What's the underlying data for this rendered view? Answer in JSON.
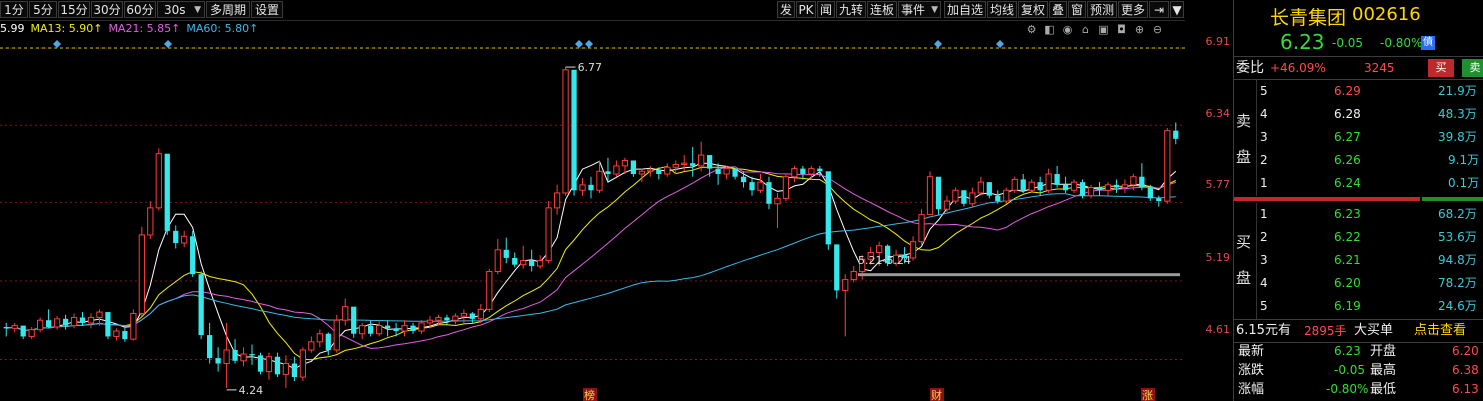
{
  "toolbar": {
    "left": [
      "1分",
      "5分",
      "15分",
      "30分",
      "60分",
      "30s"
    ],
    "period_arrow": "▼",
    "multi_period": "多周期",
    "settings": "设置",
    "right": [
      "发",
      "PK",
      "闻",
      "九转",
      "连板",
      "事件"
    ],
    "event_arrow": "▼",
    "right2": [
      "加自选",
      "均线",
      "复权",
      "叠",
      "窗",
      "预测",
      "更多"
    ],
    "pin": "⇥",
    "pin_arrow": "▼"
  },
  "ma_legend": {
    "price": "5.99",
    "ma13": "MA13: 5.90↑",
    "ma21": "MA21: 5.85↑",
    "ma60": "MA60: 5.80↑"
  },
  "colors": {
    "up": "#ff3b3b",
    "down": "#35e8ec",
    "ma_short": "#ffffff",
    "ma13": "#f0f000",
    "ma21": "#e060e0",
    "ma60": "#39b9e8",
    "grid": "#7a1a1a",
    "dash_top": "#c8c800",
    "support": "#9a9a9a"
  },
  "price_axis": [
    "6.91",
    "6.34",
    "5.77",
    "5.19",
    "4.61"
  ],
  "chart_data": {
    "type": "candlestick",
    "ylim": [
      4.34,
      6.97
    ],
    "annotations": {
      "high": "6.77",
      "low": "4.24",
      "range": "5.21-5.24"
    },
    "bottom_markers": [
      "榜",
      "财",
      "涨"
    ],
    "bars": [
      [
        4.85,
        4.88,
        4.78,
        4.84
      ],
      [
        4.84,
        4.88,
        4.81,
        4.86
      ],
      [
        4.86,
        4.85,
        4.76,
        4.78
      ],
      [
        4.78,
        4.85,
        4.76,
        4.83
      ],
      [
        4.83,
        4.92,
        4.81,
        4.9
      ],
      [
        4.9,
        4.98,
        4.84,
        4.85
      ],
      [
        4.85,
        4.93,
        4.83,
        4.91
      ],
      [
        4.91,
        4.94,
        4.83,
        4.86
      ],
      [
        4.86,
        4.95,
        4.84,
        4.92
      ],
      [
        4.92,
        4.96,
        4.86,
        4.88
      ],
      [
        4.88,
        4.95,
        4.84,
        4.92
      ],
      [
        4.92,
        4.98,
        4.86,
        4.96
      ],
      [
        4.96,
        4.96,
        4.76,
        4.78
      ],
      [
        4.78,
        4.84,
        4.75,
        4.82
      ],
      [
        4.82,
        4.85,
        4.74,
        4.76
      ],
      [
        4.76,
        4.98,
        4.75,
        4.95
      ],
      [
        4.95,
        5.59,
        4.93,
        5.53
      ],
      [
        5.53,
        5.78,
        5.5,
        5.73
      ],
      [
        5.73,
        6.17,
        5.71,
        6.13
      ],
      [
        6.13,
        5.9,
        5.53,
        5.56
      ],
      [
        5.56,
        5.6,
        5.43,
        5.47
      ],
      [
        5.47,
        5.56,
        5.44,
        5.52
      ],
      [
        5.52,
        5.56,
        5.22,
        5.24
      ],
      [
        5.24,
        5.26,
        4.76,
        4.79
      ],
      [
        4.79,
        4.88,
        4.58,
        4.62
      ],
      [
        4.62,
        4.7,
        4.52,
        4.58
      ],
      [
        4.58,
        4.88,
        4.4,
        4.68
      ],
      [
        4.68,
        4.76,
        4.58,
        4.6
      ],
      [
        4.6,
        4.7,
        4.56,
        4.65
      ],
      [
        4.65,
        4.72,
        4.57,
        4.64
      ],
      [
        4.64,
        4.66,
        4.5,
        4.52
      ],
      [
        4.52,
        4.66,
        4.46,
        4.63
      ],
      [
        4.63,
        4.66,
        4.48,
        4.5
      ],
      [
        4.5,
        4.64,
        4.4,
        4.58
      ],
      [
        4.58,
        4.63,
        4.45,
        4.48
      ],
      [
        4.48,
        4.7,
        4.45,
        4.68
      ],
      [
        4.68,
        4.78,
        4.66,
        4.74
      ],
      [
        4.74,
        4.83,
        4.7,
        4.8
      ],
      [
        4.8,
        4.81,
        4.64,
        4.68
      ],
      [
        4.68,
        4.94,
        4.66,
        4.9
      ],
      [
        4.9,
        5.06,
        4.86,
        5.0
      ],
      [
        5.0,
        4.97,
        4.77,
        4.8
      ],
      [
        4.8,
        4.88,
        4.76,
        4.86
      ],
      [
        4.86,
        4.9,
        4.78,
        4.8
      ],
      [
        4.8,
        4.9,
        4.78,
        4.86
      ],
      [
        4.86,
        4.9,
        4.78,
        4.84
      ],
      [
        4.84,
        4.88,
        4.78,
        4.82
      ],
      [
        4.82,
        4.9,
        4.78,
        4.86
      ],
      [
        4.86,
        4.88,
        4.8,
        4.82
      ],
      [
        4.82,
        4.9,
        4.8,
        4.88
      ],
      [
        4.88,
        4.93,
        4.84,
        4.9
      ],
      [
        4.9,
        4.94,
        4.86,
        4.92
      ],
      [
        4.92,
        4.94,
        4.86,
        4.9
      ],
      [
        4.9,
        4.95,
        4.87,
        4.93
      ],
      [
        4.93,
        4.98,
        4.88,
        4.95
      ],
      [
        4.95,
        4.96,
        4.88,
        4.91
      ],
      [
        4.91,
        5.02,
        4.88,
        4.98
      ],
      [
        4.98,
        5.28,
        4.96,
        5.26
      ],
      [
        5.26,
        5.5,
        5.24,
        5.42
      ],
      [
        5.42,
        5.51,
        5.32,
        5.36
      ],
      [
        5.36,
        5.4,
        5.29,
        5.31
      ],
      [
        5.31,
        5.45,
        5.28,
        5.34
      ],
      [
        5.34,
        5.42,
        5.26,
        5.3
      ],
      [
        5.3,
        5.38,
        5.28,
        5.34
      ],
      [
        5.34,
        5.78,
        5.32,
        5.73
      ],
      [
        5.73,
        5.9,
        5.68,
        5.84
      ],
      [
        5.84,
        6.77,
        5.82,
        6.75
      ],
      [
        6.75,
        5.98,
        5.82,
        5.86
      ],
      [
        5.86,
        5.95,
        5.82,
        5.9
      ],
      [
        5.9,
        5.96,
        5.8,
        5.86
      ],
      [
        5.86,
        6.08,
        5.84,
        6.0
      ],
      [
        6.0,
        6.1,
        5.92,
        5.98
      ],
      [
        5.98,
        6.08,
        5.96,
        6.04
      ],
      [
        6.04,
        6.1,
        5.98,
        6.08
      ],
      [
        6.08,
        6.06,
        5.96,
        5.98
      ],
      [
        5.98,
        6.02,
        5.92,
        6.0
      ],
      [
        6.0,
        6.04,
        5.96,
        6.01
      ],
      [
        6.01,
        6.03,
        5.94,
        5.98
      ],
      [
        5.98,
        6.06,
        5.96,
        6.03
      ],
      [
        6.03,
        6.08,
        5.98,
        6.05
      ],
      [
        6.05,
        6.12,
        6.0,
        6.06
      ],
      [
        6.06,
        6.18,
        5.96,
        6.04
      ],
      [
        6.04,
        6.22,
        6.0,
        6.12
      ],
      [
        6.12,
        6.06,
        5.96,
        6.02
      ],
      [
        6.02,
        6.06,
        5.9,
        5.98
      ],
      [
        5.98,
        6.04,
        5.94,
        6.02
      ],
      [
        6.02,
        6.02,
        5.94,
        5.96
      ],
      [
        5.96,
        6.0,
        5.88,
        5.92
      ],
      [
        5.92,
        5.96,
        5.82,
        5.86
      ],
      [
        5.86,
        5.98,
        5.84,
        5.92
      ],
      [
        5.92,
        5.96,
        5.72,
        5.76
      ],
      [
        5.76,
        5.84,
        5.58,
        5.8
      ],
      [
        5.8,
        5.98,
        5.78,
        5.96
      ],
      [
        5.96,
        6.04,
        5.92,
        6.02
      ],
      [
        6.02,
        6.04,
        5.94,
        5.98
      ],
      [
        5.98,
        6.04,
        5.94,
        6.02
      ],
      [
        6.02,
        6.04,
        5.96,
        6.0
      ],
      [
        6.0,
        5.72,
        5.42,
        5.46
      ],
      [
        5.46,
        5.34,
        5.06,
        5.12
      ],
      [
        5.12,
        5.24,
        4.78,
        5.2
      ],
      [
        5.2,
        5.3,
        5.18,
        5.26
      ],
      [
        5.26,
        5.38,
        5.2,
        5.35
      ],
      [
        5.35,
        5.44,
        5.31,
        5.4
      ],
      [
        5.4,
        5.48,
        5.3,
        5.45
      ],
      [
        5.45,
        5.46,
        5.3,
        5.32
      ],
      [
        5.32,
        5.42,
        5.3,
        5.38
      ],
      [
        5.38,
        5.44,
        5.32,
        5.36
      ],
      [
        5.36,
        5.52,
        5.34,
        5.48
      ],
      [
        5.48,
        5.72,
        5.46,
        5.68
      ],
      [
        5.68,
        6.0,
        5.7,
        5.96
      ],
      [
        5.96,
        5.92,
        5.68,
        5.72
      ],
      [
        5.72,
        5.82,
        5.7,
        5.78
      ],
      [
        5.78,
        5.88,
        5.76,
        5.86
      ],
      [
        5.86,
        5.84,
        5.74,
        5.76
      ],
      [
        5.76,
        5.88,
        5.74,
        5.84
      ],
      [
        5.84,
        5.96,
        5.82,
        5.92
      ],
      [
        5.92,
        5.9,
        5.8,
        5.82
      ],
      [
        5.82,
        5.86,
        5.76,
        5.78
      ],
      [
        5.78,
        5.88,
        5.76,
        5.86
      ],
      [
        5.86,
        5.96,
        5.84,
        5.94
      ],
      [
        5.94,
        5.98,
        5.84,
        5.86
      ],
      [
        5.86,
        5.94,
        5.84,
        5.92
      ],
      [
        5.92,
        5.96,
        5.82,
        5.86
      ],
      [
        5.86,
        6.02,
        5.84,
        5.98
      ],
      [
        5.98,
        6.04,
        5.88,
        5.9
      ],
      [
        5.9,
        5.96,
        5.84,
        5.86
      ],
      [
        5.86,
        5.94,
        5.84,
        5.92
      ],
      [
        5.92,
        5.94,
        5.8,
        5.82
      ],
      [
        5.82,
        5.9,
        5.8,
        5.88
      ],
      [
        5.88,
        5.92,
        5.82,
        5.86
      ],
      [
        5.86,
        5.92,
        5.82,
        5.9
      ],
      [
        5.9,
        5.94,
        5.84,
        5.88
      ],
      [
        5.88,
        5.94,
        5.84,
        5.9
      ],
      [
        5.9,
        5.98,
        5.86,
        5.96
      ],
      [
        5.96,
        6.06,
        5.86,
        5.88
      ],
      [
        5.88,
        5.9,
        5.78,
        5.8
      ],
      [
        5.8,
        5.82,
        5.74,
        5.78
      ],
      [
        5.78,
        6.32,
        5.76,
        6.3
      ],
      [
        6.3,
        6.36,
        6.2,
        6.24
      ]
    ]
  },
  "quote": {
    "name": "长青集团",
    "code": "002616",
    "price": "6.23",
    "change": "-0.05",
    "change_pct": "-0.80%",
    "badge": "債",
    "weibi_label": "委比",
    "weibi_value": "+46.09%",
    "weicha_value": "3245",
    "buy_btn": "买",
    "sell_btn": "卖",
    "sell_side_label": [
      "卖",
      "盘"
    ],
    "buy_side_label": [
      "买",
      "盘"
    ],
    "asks": [
      {
        "lvl": "5",
        "price": "6.29",
        "vol": "21.9万"
      },
      {
        "lvl": "4",
        "price": "6.28",
        "vol": "48.3万"
      },
      {
        "lvl": "3",
        "price": "6.27",
        "vol": "39.8万"
      },
      {
        "lvl": "2",
        "price": "6.26",
        "vol": "9.1万"
      },
      {
        "lvl": "1",
        "price": "6.24",
        "vol": "0.1万"
      }
    ],
    "bids": [
      {
        "lvl": "1",
        "price": "6.23",
        "vol": "68.2万"
      },
      {
        "lvl": "2",
        "price": "6.22",
        "vol": "53.6万"
      },
      {
        "lvl": "3",
        "price": "6.21",
        "vol": "94.8万"
      },
      {
        "lvl": "4",
        "price": "6.20",
        "vol": "78.2万"
      },
      {
        "lvl": "5",
        "price": "6.19",
        "vol": "24.6万"
      }
    ],
    "big_order": {
      "price": "6.15元有",
      "qty": "2895手",
      "label": "大买单",
      "link": "点击查看"
    },
    "stats": [
      {
        "k1": "最新",
        "v1": "6.23",
        "k2": "开盘",
        "v2": "6.20"
      },
      {
        "k1": "涨跌",
        "v1": "-0.05",
        "k2": "最高",
        "v2": "6.38"
      },
      {
        "k1": "涨幅",
        "v1": "-0.80%",
        "k2": "最低",
        "v2": "6.13"
      }
    ]
  }
}
